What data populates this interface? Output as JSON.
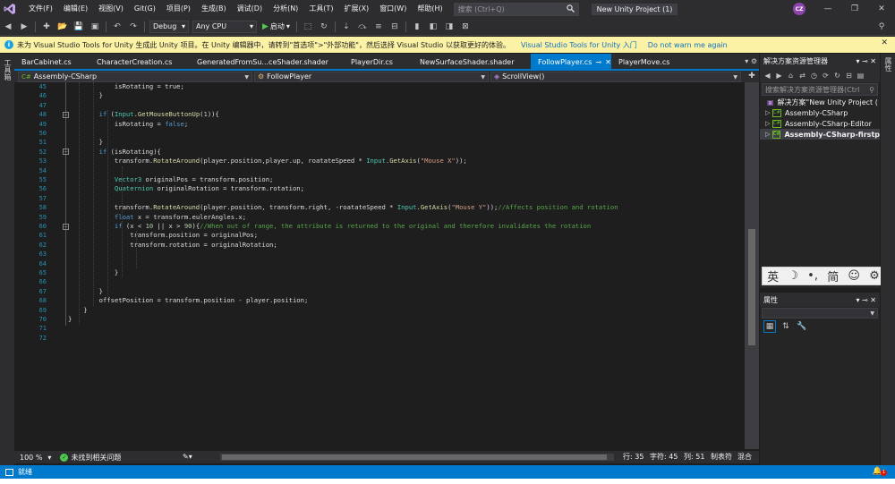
{
  "menu": [
    "文件(F)",
    "编辑(E)",
    "视图(V)",
    "Git(G)",
    "项目(P)",
    "生成(B)",
    "调试(D)",
    "分析(N)",
    "工具(T)",
    "扩展(X)",
    "窗口(W)",
    "帮助(H)"
  ],
  "search": {
    "placeholder": "搜索 (Ctrl+Q)"
  },
  "project_title": "New Unity Project (1)",
  "user_initials": "CZ",
  "toolbar": {
    "config": "Debug",
    "platform": "Any CPU",
    "start_label": "启动"
  },
  "infobar": {
    "message": "未为 Visual Studio Tools for Unity 生成此 Unity 项目。在 Unity 编辑器中，请转到\"首选项\">\"外部功能\"，然后选择 Visual Studio 以获取更好的体验。",
    "link1": "Visual Studio Tools for Unity 入门",
    "link2": "Do not warn me again"
  },
  "left_strip_label": "工具箱",
  "right_strip_label": "属性",
  "tabs": [
    {
      "label": "BarCabinet.cs",
      "active": false
    },
    {
      "label": "CharacterCreation.cs",
      "active": false
    },
    {
      "label": "GeneratedFromSu...ceShader.shader",
      "active": false
    },
    {
      "label": "PlayerDir.cs",
      "active": false
    },
    {
      "label": "NewSurfaceShader.shader",
      "active": false
    },
    {
      "label": "FollowPlayer.cs",
      "active": true
    },
    {
      "label": "PlayerMove.cs",
      "active": false
    }
  ],
  "navbar": {
    "project": "Assembly-CSharp",
    "class": "FollowPlayer",
    "member": "ScrollView()"
  },
  "code": {
    "line_numbers": [
      "45",
      "46",
      "47",
      "48",
      "49",
      "50",
      "51",
      "52",
      "53",
      "54",
      "55",
      "56",
      "57",
      "58",
      "59",
      "60",
      "61",
      "62",
      "63",
      "64",
      "65",
      "66",
      "67",
      "68",
      "69",
      "70",
      "71",
      "72"
    ],
    "lines": [
      [
        [
          "",
          "            isRotating = true;"
        ]
      ],
      [
        [
          "",
          "        }"
        ]
      ],
      [
        [
          "",
          ""
        ]
      ],
      [
        [
          "kw",
          "        if "
        ],
        [
          "",
          "("
        ],
        [
          "ty",
          "Input"
        ],
        [
          "",
          "."
        ],
        [
          "fn",
          "GetMouseButtonUp"
        ],
        [
          "",
          "("
        ],
        [
          "num",
          "1"
        ],
        [
          "",
          ")){"
        ]
      ],
      [
        [
          "",
          "            isRotating = "
        ],
        [
          "kw",
          "false"
        ],
        [
          "",
          ";"
        ]
      ],
      [
        [
          "",
          ""
        ]
      ],
      [
        [
          "",
          "        }"
        ]
      ],
      [
        [
          "kw",
          "        if "
        ],
        [
          "",
          "(isRotating){"
        ]
      ],
      [
        [
          "",
          "            transform."
        ],
        [
          "fn",
          "RotateAround"
        ],
        [
          "",
          "(player.position,player.up, roatateSpeed * "
        ],
        [
          "ty",
          "Input"
        ],
        [
          "",
          "."
        ],
        [
          "fn",
          "GetAxis"
        ],
        [
          "",
          "("
        ],
        [
          "str",
          "\"Mouse X\""
        ],
        [
          "",
          "));"
        ]
      ],
      [
        [
          "",
          ""
        ]
      ],
      [
        [
          "ty",
          "            Vector3"
        ],
        [
          "",
          " originalPos = transform.position;"
        ]
      ],
      [
        [
          "ty",
          "            Quaternion"
        ],
        [
          "",
          " originalRotation = transform.rotation;"
        ]
      ],
      [
        [
          "",
          ""
        ]
      ],
      [
        [
          "",
          "            transform."
        ],
        [
          "fn",
          "RotateAround"
        ],
        [
          "",
          "(player.position, transform.right, -roatateSpeed * "
        ],
        [
          "ty",
          "Input"
        ],
        [
          "",
          "."
        ],
        [
          "fn",
          "GetAxis"
        ],
        [
          "",
          "("
        ],
        [
          "str",
          "\"Mouse Y\""
        ],
        [
          "",
          "));"
        ],
        [
          "cm",
          "//Affects position and rotation"
        ]
      ],
      [
        [
          "kw",
          "            float"
        ],
        [
          "",
          " x = transform.eulerAngles.x;"
        ]
      ],
      [
        [
          "kw",
          "            if "
        ],
        [
          "",
          "(x < "
        ],
        [
          "num",
          "10"
        ],
        [
          "",
          " || x > "
        ],
        [
          "num",
          "90"
        ],
        [
          "",
          "){"
        ],
        [
          "cm",
          "//When out of range, the attribute is returned to the original and therefore invalidates the rotation"
        ]
      ],
      [
        [
          "",
          "                transform.position = originalPos;"
        ]
      ],
      [
        [
          "",
          "                transform.rotation = originalRotation;"
        ]
      ],
      [
        [
          "",
          ""
        ]
      ],
      [
        [
          "",
          ""
        ]
      ],
      [
        [
          "",
          "            }"
        ]
      ],
      [
        [
          "",
          ""
        ]
      ],
      [
        [
          "",
          "        }"
        ]
      ],
      [
        [
          "",
          "        offsetPosition = transform.position - player.position;"
        ]
      ],
      [
        [
          "",
          "    }"
        ]
      ],
      [
        [
          "",
          "}"
        ]
      ],
      [
        [
          "",
          ""
        ]
      ],
      [
        [
          "",
          ""
        ]
      ]
    ]
  },
  "editor_status": {
    "zoom": "100 %",
    "issues": "未找到相关问题",
    "line": "行: 35",
    "char": "字符: 45",
    "col": "列: 51",
    "tabs": "制表符",
    "eol": "混合"
  },
  "solution_explorer": {
    "title": "解决方案资源管理器",
    "search_placeholder": "搜索解决方案资源管理器(Ctrl",
    "items": [
      {
        "label": "解决方案\"New Unity Project (",
        "type": "solution"
      },
      {
        "label": "Assembly-CSharp",
        "type": "project"
      },
      {
        "label": "Assembly-CSharp-Editor",
        "type": "project"
      },
      {
        "label": "Assembly-CSharp-firstp",
        "type": "project",
        "bold": true
      }
    ]
  },
  "ime": {
    "lang": "英",
    "moon": "☽",
    "punct": "•,",
    "mode": "简",
    "emoji": "☺",
    "settings": "⚙"
  },
  "properties": {
    "title": "属性"
  },
  "statusbar": {
    "ready": "就绪",
    "notifications": "1"
  },
  "colors": {
    "accent": "#007acc",
    "infobar": "#fcf2a5",
    "editor_bg": "#1e1e1e"
  }
}
